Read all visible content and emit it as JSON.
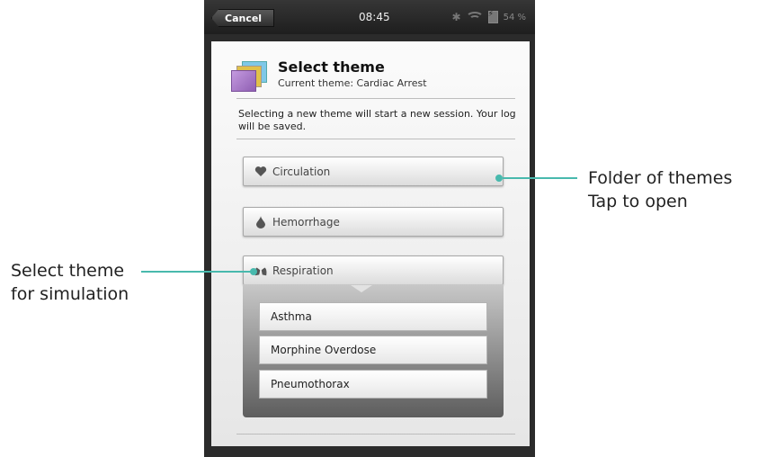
{
  "status_bar": {
    "cancel_label": "Cancel",
    "time": "08:45",
    "battery": "54 %"
  },
  "header": {
    "title": "Select theme",
    "subtitle": "Current theme: Cardiac Arrest",
    "icon": "folder-stack-icon"
  },
  "info_text": "Selecting a new theme will start a new session. Your log will be saved.",
  "categories": [
    {
      "label": "Circulation",
      "icon": "heart-icon"
    },
    {
      "label": "Hemorrhage",
      "icon": "blood-drop-icon"
    },
    {
      "label": "Respiration",
      "icon": "lungs-icon"
    }
  ],
  "respiration_themes": [
    "Asthma",
    "Morphine Overdose",
    "Pneumothorax"
  ],
  "callouts": {
    "right_line1": "Folder of themes",
    "right_line2": "Tap to open",
    "left_line1": "Select theme",
    "left_line2": "for simulation"
  },
  "colors": {
    "accent": "#48b9ad"
  }
}
